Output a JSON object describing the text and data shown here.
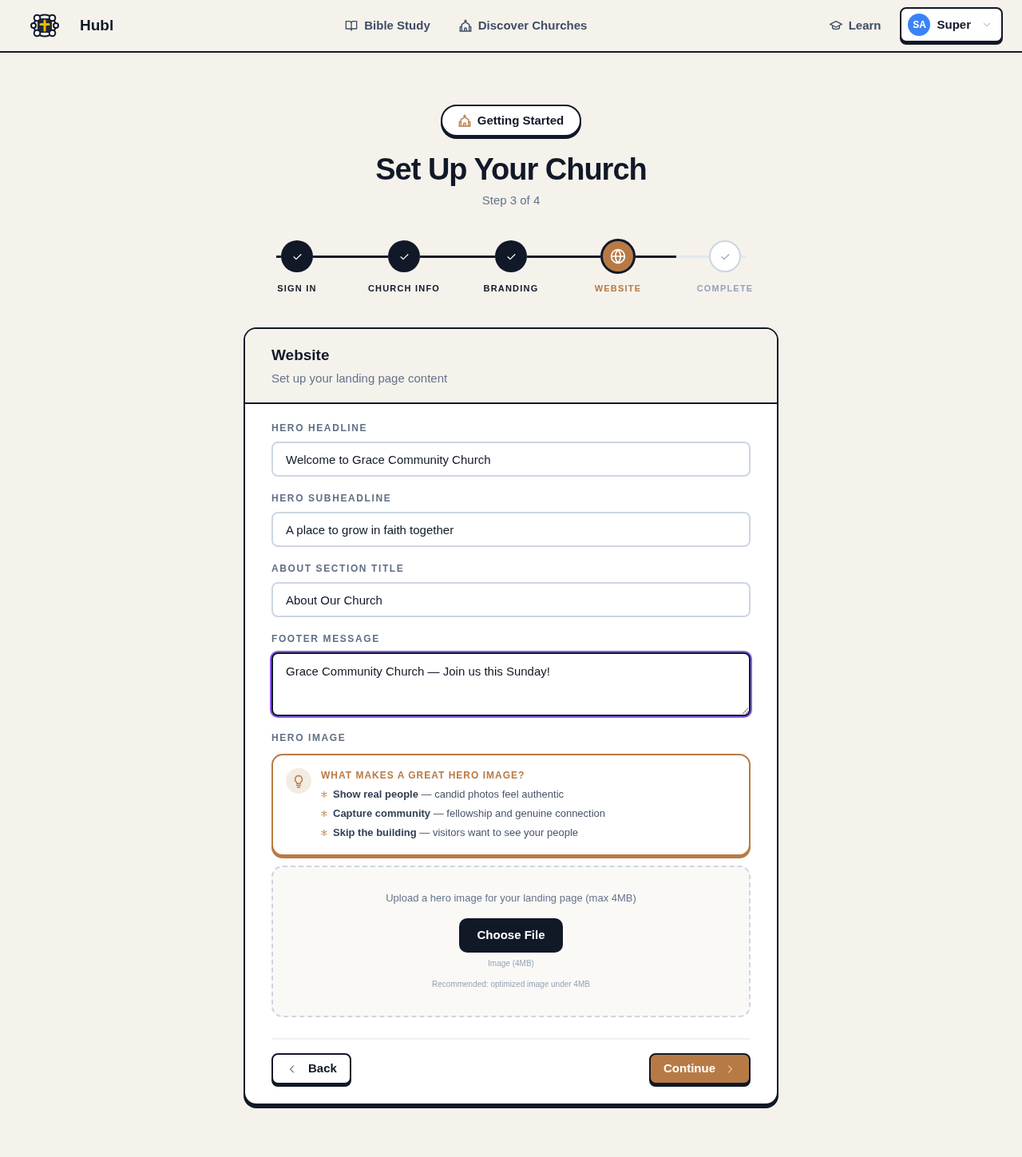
{
  "header": {
    "brand": "Hubl",
    "nav": [
      {
        "label": "Bible Study"
      },
      {
        "label": "Discover Churches"
      }
    ],
    "learn": "Learn",
    "user": {
      "initials": "SA",
      "name": "Super"
    }
  },
  "badge": "Getting Started",
  "title": "Set Up Your Church",
  "step_text": "Step 3 of 4",
  "stepper": {
    "steps": [
      {
        "label": "SIGN IN",
        "done": true,
        "selected": false
      },
      {
        "label": "CHURCH INFO",
        "done": true,
        "selected": false
      },
      {
        "label": "BRANDING",
        "done": true,
        "selected": false
      },
      {
        "label": "WEBSITE",
        "done": false,
        "selected": true
      },
      {
        "label": "COMPLETE",
        "done": false,
        "selected": false
      }
    ]
  },
  "card": {
    "title": "Website",
    "subtitle": "Set up your landing page content",
    "fields": [
      {
        "label": "HERO HEADLINE",
        "kind": "input",
        "value": "Welcome to Grace Community Church",
        "focused": false
      },
      {
        "label": "HERO SUBHEADLINE",
        "kind": "input",
        "value": "A place to grow in faith together",
        "focused": false
      },
      {
        "label": "ABOUT SECTION TITLE",
        "kind": "input",
        "value": "About Our Church",
        "focused": false
      },
      {
        "label": "FOOTER MESSAGE",
        "kind": "textarea",
        "value": "Grace Community Church — Join us this Sunday!",
        "focused": true
      }
    ],
    "hero_image": {
      "label": "HERO IMAGE",
      "tips": {
        "title": "WHAT MAKES A GREAT HERO IMAGE?",
        "items": [
          "**Show real people** — candid photos feel authentic",
          "**Capture community** — fellowship and genuine connection",
          "**Skip the building** — visitors want to see your people"
        ]
      },
      "upload": {
        "prompt": "Upload a hero image for your landing page (max 4MB)",
        "button": "Choose File",
        "file_type": "Image (4MB)",
        "recommendation": "Recommended: optimized image under 4MB"
      }
    },
    "actions": {
      "back": "Back",
      "continue": "Continue"
    }
  }
}
